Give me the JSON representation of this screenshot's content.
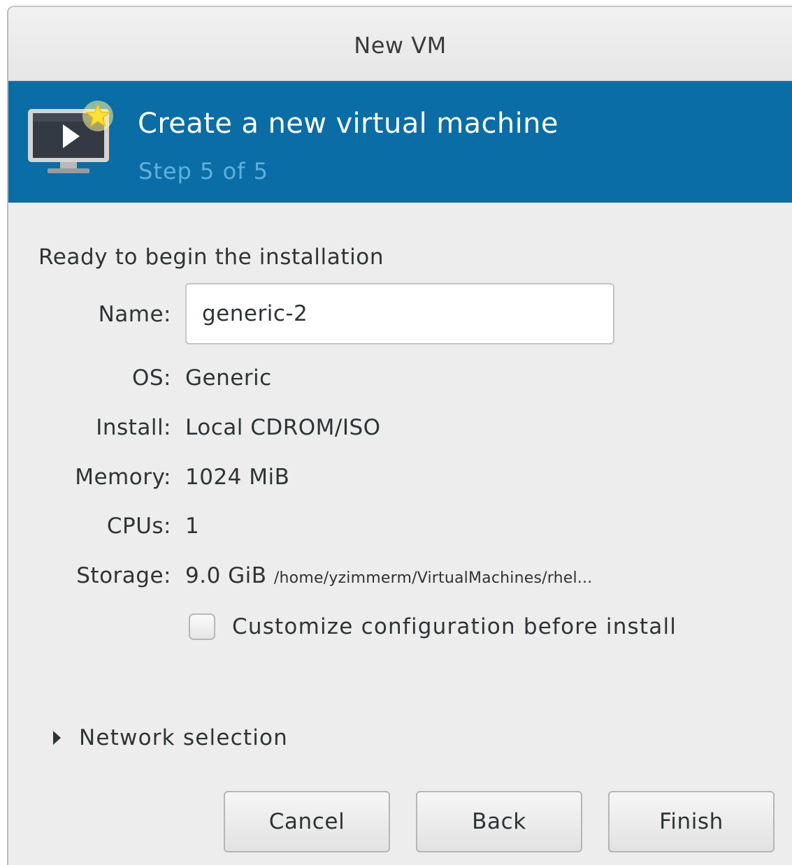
{
  "window": {
    "title": "New VM"
  },
  "banner": {
    "heading": "Create a new virtual machine",
    "step": "Step 5 of 5",
    "icon": "vm-monitor-play-icon"
  },
  "summary": {
    "ready_text": "Ready to begin the installation",
    "name_label": "Name:",
    "name_value": "generic-2",
    "os_label": "OS:",
    "os_value": "Generic",
    "install_label": "Install:",
    "install_value": "Local CDROM/ISO",
    "memory_label": "Memory:",
    "memory_value": "1024 MiB",
    "cpus_label": "CPUs:",
    "cpus_value": "1",
    "storage_label": "Storage:",
    "storage_size": "9.0 GiB",
    "storage_path": "/home/yzimmerm/VirtualMachines/rhel..."
  },
  "customize": {
    "label": "Customize configuration before install",
    "checked": false
  },
  "network": {
    "label": "Network selection",
    "expanded": false
  },
  "buttons": {
    "cancel": "Cancel",
    "back": "Back",
    "finish": "Finish"
  },
  "colors": {
    "banner": "#0a6da6",
    "step_text": "#5fb0de",
    "background": "#ededed"
  }
}
